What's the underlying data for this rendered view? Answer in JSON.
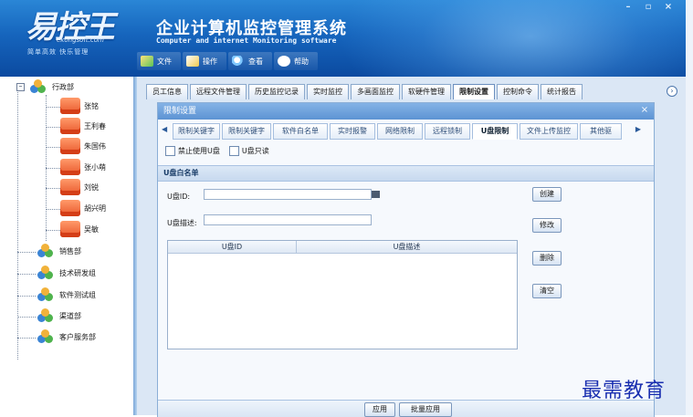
{
  "window": {
    "title": "企业计算机监控管理系统",
    "subtitle": "Computer and internet Monitoring software",
    "controls": [
      "–",
      "▫",
      "×"
    ]
  },
  "logo": {
    "mark": "易控王",
    "url": "ekongsoft.com",
    "slogan": "简单高效 快乐管理"
  },
  "toolbar": [
    {
      "label": "文件",
      "icon": "file-icon"
    },
    {
      "label": "操作",
      "icon": "tools-icon"
    },
    {
      "label": "查看",
      "icon": "search-icon"
    },
    {
      "label": "帮助",
      "icon": "help-icon"
    }
  ],
  "tree": {
    "root": "行政部",
    "users": [
      "张铭",
      "王利春",
      "朱国伟",
      "张小萌",
      "刘锐",
      "胡兴明",
      "吴敏"
    ],
    "groups": [
      "销售部",
      "技术研发组",
      "软件测试组",
      "渠道部",
      "客户服务部"
    ]
  },
  "main_tabs": [
    "员工信息",
    "远程文件管理",
    "历史监控记录",
    "实时监控",
    "多画面监控",
    "软硬件管理",
    "限制设置",
    "控制命令",
    "统计报告"
  ],
  "active_main_tab": "限制设置",
  "panel": {
    "title": "限制设置",
    "close": "×",
    "sub_tabs": [
      "限制关键字",
      "限制关键字",
      "软件白名单",
      "实时报警",
      "网络限制",
      "远程锁制",
      "U盘限制",
      "文件上传监控",
      "其他驱"
    ],
    "active_sub_tab": "U盘限制",
    "checkbox_disable_usb": "禁止使用U盘",
    "checkbox_readonly_usb": "U盘只读",
    "section_title": "U盘白名单",
    "usb_id_label": "U盘ID:",
    "usb_id_value": "",
    "usb_desc_label": "U盘描述:",
    "usb_desc_value": "",
    "buttons": {
      "create": "创建",
      "modify": "修改",
      "delete": "删除",
      "clear": "清空",
      "apply": "应用",
      "batch_apply": "批量应用"
    },
    "table_headers": [
      "U盘ID",
      "U盘描述"
    ]
  },
  "watermark": "最需教育"
}
